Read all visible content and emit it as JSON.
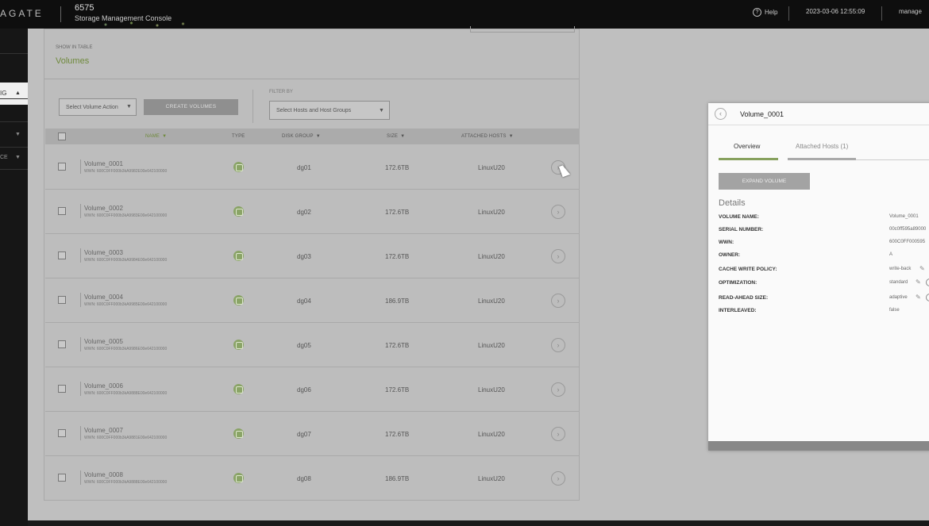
{
  "header": {
    "brand": "AGATE",
    "product_number": "6575",
    "product_name": "Storage Management Console",
    "help_label": "Help",
    "datetime": "2023-03-06 12:55:09",
    "user": "manage"
  },
  "nav": {
    "active_label": "IG",
    "items": [
      "",
      "CE"
    ]
  },
  "main": {
    "show_in_table": "SHOW IN TABLE",
    "title": "Volumes",
    "volume_action_placeholder": "Select Volume Action",
    "create_button": "CREATE VOLUMES",
    "filter_by": "FILTER BY",
    "hosts_placeholder": "Select Hosts and Host Groups",
    "columns": [
      "NAME",
      "TYPE",
      "DISK GROUP",
      "SIZE",
      "ATTACHED HOSTS"
    ],
    "rows": [
      {
        "name": "Volume_0001",
        "wwn": "WWN: 600C0FF000b3kA9982E00e642100000",
        "disk_group": "dg01",
        "size": "172.6TB",
        "host": "LinuxU20"
      },
      {
        "name": "Volume_0002",
        "wwn": "WWN: 600C0FF000b3kA9983E00e642100000",
        "disk_group": "dg02",
        "size": "172.6TB",
        "host": "LinuxU20"
      },
      {
        "name": "Volume_0003",
        "wwn": "WWN: 600C0FF000b3kA9984E00e642100000",
        "disk_group": "dg03",
        "size": "172.6TB",
        "host": "LinuxU20"
      },
      {
        "name": "Volume_0004",
        "wwn": "WWN: 600C0FF000b3kA9985E00e642100000",
        "disk_group": "dg04",
        "size": "186.9TB",
        "host": "LinuxU20"
      },
      {
        "name": "Volume_0005",
        "wwn": "WWN: 600C0FF000b3kA9986E00e642100000",
        "disk_group": "dg05",
        "size": "172.6TB",
        "host": "LinuxU20"
      },
      {
        "name": "Volume_0006",
        "wwn": "WWN: 600C0FF000b3kA9888E00e642100000",
        "disk_group": "dg06",
        "size": "172.6TB",
        "host": "LinuxU20"
      },
      {
        "name": "Volume_0007",
        "wwn": "WWN: 600C0FF000b3kA9881E00e642100000",
        "disk_group": "dg07",
        "size": "172.6TB",
        "host": "LinuxU20"
      },
      {
        "name": "Volume_0008",
        "wwn": "WWN: 600C0FF000b3kA9888E00e642100000",
        "disk_group": "dg08",
        "size": "186.9TB",
        "host": "LinuxU20"
      }
    ]
  },
  "detail": {
    "title": "Volume_0001",
    "tabs": [
      "Overview",
      "Attached Hosts (1)"
    ],
    "expand_button": "EXPAND VOLUME",
    "section": "Details",
    "properties": [
      {
        "label": "VOLUME NAME:",
        "value": "Volume_0001"
      },
      {
        "label": "SERIAL NUMBER:",
        "value": "00c0ff595a89000"
      },
      {
        "label": "WWN:",
        "value": "600C0FF000595"
      },
      {
        "label": "OWNER:",
        "value": "A"
      },
      {
        "label": "CACHE WRITE POLICY:",
        "value": "write-back"
      },
      {
        "label": "OPTIMIZATION:",
        "value": "standard"
      },
      {
        "label": "READ-AHEAD SIZE:",
        "value": "adaptive"
      },
      {
        "label": "INTERLEAVED:",
        "value": "false"
      }
    ]
  }
}
